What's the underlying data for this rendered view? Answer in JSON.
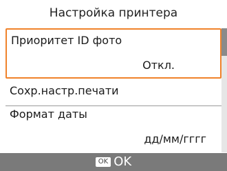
{
  "screen": {
    "title": "Настройка принтера"
  },
  "menu": {
    "items": [
      {
        "label": "Приоритет ID фото",
        "value": "Откл.",
        "selected": true
      },
      {
        "label": "Сохр.настр.печати",
        "value": ""
      },
      {
        "label": "Формат даты",
        "value": "дд/мм/гггг"
      }
    ]
  },
  "footer": {
    "ok_key": "OK",
    "ok_label": "OK"
  },
  "scroll": {
    "position_fraction": 0.0
  },
  "colors": {
    "selection_border": "#f0822a",
    "footer_background": "#7a7a7a"
  }
}
